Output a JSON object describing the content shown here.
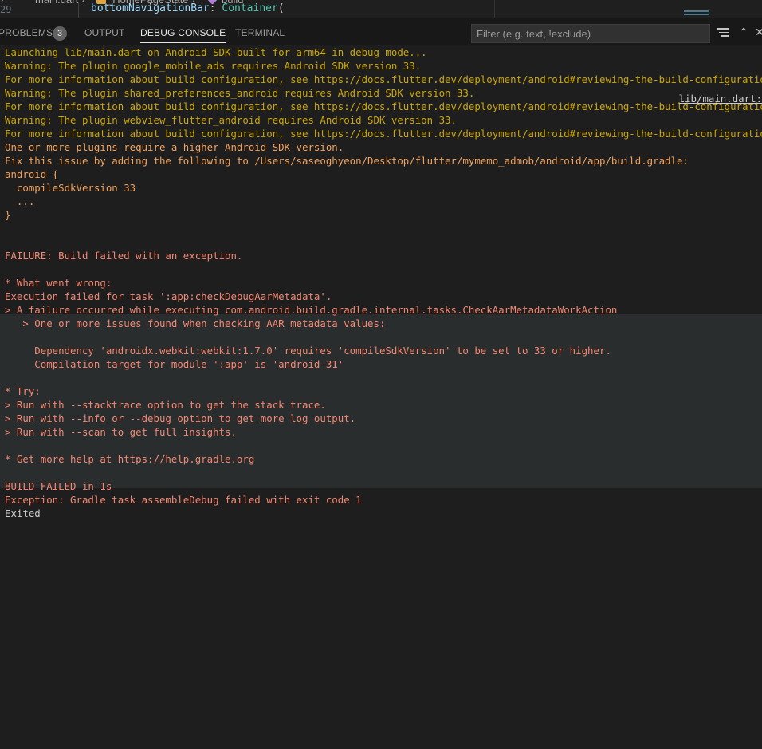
{
  "editor": {
    "breadcrumb": [
      {
        "label": "›",
        "icon": ""
      },
      {
        "label": "main.dart  ›",
        "icon": ""
      },
      {
        "label": "_HomePageState  ›",
        "icon": "class-icon"
      },
      {
        "label": "build",
        "icon": "method-icon"
      }
    ],
    "line_number": "29",
    "code": {
      "prop": "bottomNavigationBar",
      "punct": ": ",
      "type": "Container",
      "tail": "("
    }
  },
  "panel": {
    "tabs": [
      {
        "label": "PROBLEMS",
        "badge": "3",
        "active": false
      },
      {
        "label": "OUTPUT",
        "active": false
      },
      {
        "label": "DEBUG CONSOLE",
        "active": true
      },
      {
        "label": "TERMINAL",
        "active": false
      }
    ],
    "filter_placeholder": "Filter (e.g. text, !exclude)",
    "icons": [
      "filter-lines-icon",
      "chevron-up-icon",
      "close-icon"
    ]
  },
  "console": {
    "source_link": "lib/main.dart:",
    "lines": [
      {
        "text": "Launching lib/main.dart on Android SDK built for arm64 in debug mode...",
        "kind": "warn"
      },
      {
        "text": "Warning: The plugin google_mobile_ads requires Android SDK version 33.",
        "kind": "warn"
      },
      {
        "text": "For more information about build configuration, see https://docs.flutter.dev/deployment/android#reviewing-the-build-configuration.",
        "kind": "warn"
      },
      {
        "text": "Warning: The plugin shared_preferences_android requires Android SDK version 33.",
        "kind": "warn"
      },
      {
        "text": "For more information about build configuration, see https://docs.flutter.dev/deployment/android#reviewing-the-build-configuration.",
        "kind": "warn"
      },
      {
        "text": "Warning: The plugin webview_flutter_android requires Android SDK version 33.",
        "kind": "warn"
      },
      {
        "text": "For more information about build configuration, see https://docs.flutter.dev/deployment/android#reviewing-the-build-configuration.",
        "kind": "warn"
      },
      {
        "text": "One or more plugins require a higher Android SDK version.",
        "kind": "warn-err"
      },
      {
        "text": "Fix this issue by adding the following to /Users/saseoghyeon/Desktop/flutter/mymemo_admob/android/app/build.gradle:",
        "kind": "warn-err"
      },
      {
        "text": "android {",
        "kind": "warn-err"
      },
      {
        "text": "  compileSdkVersion 33",
        "kind": "warn-err"
      },
      {
        "text": "  ...",
        "kind": "warn-err"
      },
      {
        "text": "}",
        "kind": "warn-err"
      },
      {
        "text": "",
        "kind": "err"
      },
      {
        "text": "",
        "kind": "err"
      },
      {
        "text": "FAILURE: Build failed with an exception.",
        "kind": "err"
      },
      {
        "text": "",
        "kind": "err"
      },
      {
        "text": "* What went wrong:",
        "kind": "err"
      },
      {
        "text": "Execution failed for task ':app:checkDebugAarMetadata'.",
        "kind": "err"
      },
      {
        "text": "> A failure occurred while executing com.android.build.gradle.internal.tasks.CheckAarMetadataWorkAction",
        "kind": "err"
      },
      {
        "text": "   > One or more issues found when checking AAR metadata values:",
        "kind": "err"
      },
      {
        "text": "",
        "kind": "err"
      },
      {
        "text": "     Dependency 'androidx.webkit:webkit:1.7.0' requires 'compileSdkVersion' to be set to 33 or higher.",
        "kind": "err"
      },
      {
        "text": "     Compilation target for module ':app' is 'android-31'",
        "kind": "err"
      },
      {
        "text": "",
        "kind": "err"
      },
      {
        "text": "* Try:",
        "kind": "err"
      },
      {
        "text": "> Run with --stacktrace option to get the stack trace.",
        "kind": "err"
      },
      {
        "text": "> Run with --info or --debug option to get more log output.",
        "kind": "err"
      },
      {
        "text": "> Run with --scan to get full insights.",
        "kind": "err"
      },
      {
        "text": "",
        "kind": "err"
      },
      {
        "text": "* Get more help at https://help.gradle.org",
        "kind": "err"
      },
      {
        "text": "",
        "kind": "err"
      },
      {
        "text": "BUILD FAILED in 1s",
        "kind": "err"
      },
      {
        "text": "Exception: Gradle task assembleDebug failed with exit code 1",
        "kind": "err"
      },
      {
        "text": "Exited",
        "kind": "exited"
      }
    ]
  },
  "colors": {
    "warning": "#cca700",
    "error": "#f48771",
    "background": "#1e1e1e"
  }
}
